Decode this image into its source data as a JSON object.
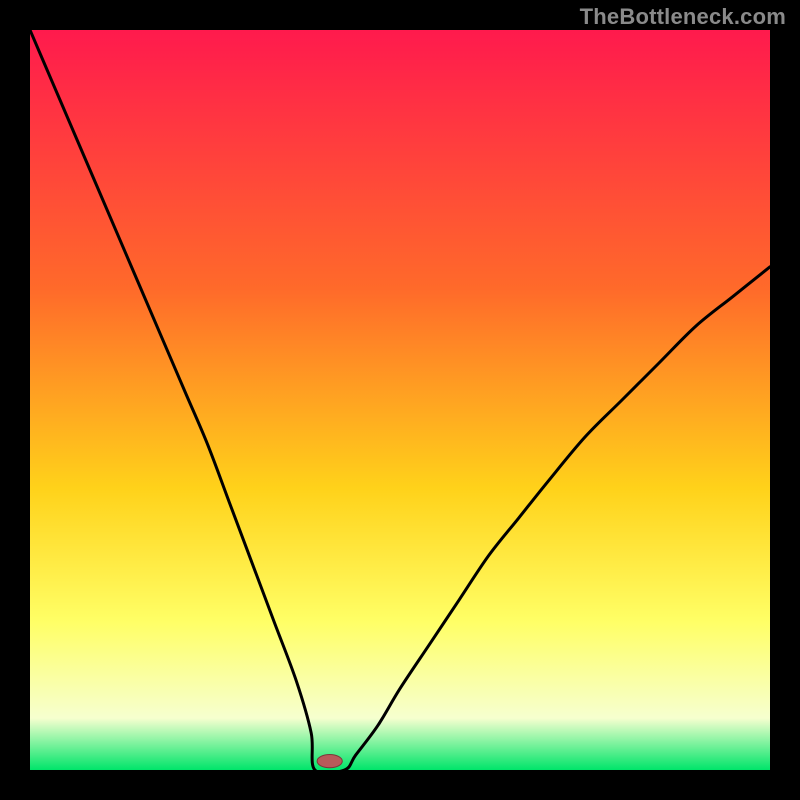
{
  "watermark": "TheBottleneck.com",
  "colors": {
    "frame": "#000000",
    "curve": "#000000",
    "marker_fill": "#b85a5a",
    "marker_stroke": "#7a3a3a",
    "grad_top": "#ff1a4d",
    "grad_mid1": "#ff6a2a",
    "grad_mid2": "#ffd21a",
    "grad_mid3": "#ffff66",
    "grad_pale": "#f6ffcf",
    "grad_green": "#00e56a"
  },
  "chart_data": {
    "type": "line",
    "title": "",
    "xlabel": "",
    "ylabel": "",
    "xlim": [
      0,
      100
    ],
    "ylim": [
      0,
      100
    ],
    "legend": false,
    "gradient_background": true,
    "gradient_stops": [
      {
        "pos": 0.0,
        "color": "#ff1a4d"
      },
      {
        "pos": 0.35,
        "color": "#ff6a2a"
      },
      {
        "pos": 0.62,
        "color": "#ffd21a"
      },
      {
        "pos": 0.8,
        "color": "#ffff66"
      },
      {
        "pos": 0.93,
        "color": "#f6ffcf"
      },
      {
        "pos": 1.0,
        "color": "#00e56a"
      }
    ],
    "series": [
      {
        "name": "bottleneck-curve",
        "x": [
          0,
          3,
          6,
          9,
          12,
          15,
          18,
          21,
          24,
          27,
          30,
          33,
          36,
          38,
          39,
          40,
          41,
          42,
          44,
          47,
          50,
          54,
          58,
          62,
          66,
          70,
          75,
          80,
          85,
          90,
          95,
          100
        ],
        "y": [
          100,
          93,
          86,
          79,
          72,
          65,
          58,
          51,
          44,
          36,
          28,
          20,
          12,
          5,
          2,
          0,
          0,
          0.5,
          2,
          6,
          11,
          17,
          23,
          29,
          34,
          39,
          45,
          50,
          55,
          60,
          64,
          68
        ]
      }
    ],
    "flat_bottom": {
      "x_start": 38.5,
      "x_end": 42.5,
      "y": 0
    },
    "marker": {
      "x": 40.5,
      "y": 1.2,
      "rx": 1.7,
      "ry": 0.9
    }
  }
}
